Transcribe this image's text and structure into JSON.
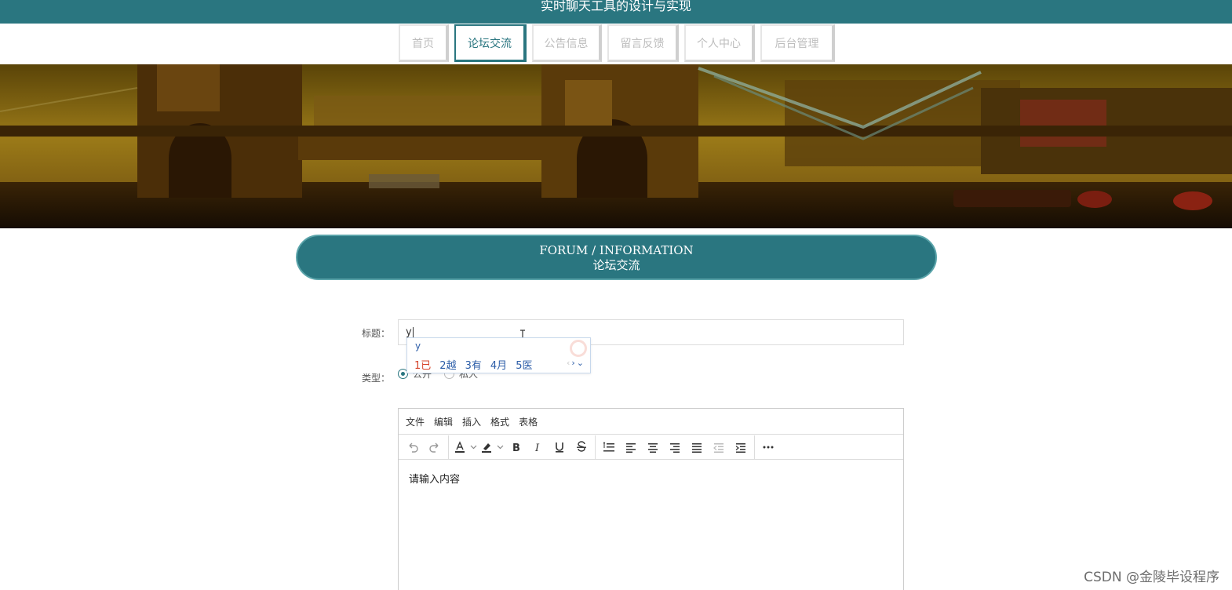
{
  "header": {
    "title": "实时聊天工具的设计与实现"
  },
  "nav": {
    "items": [
      {
        "label": "首页"
      },
      {
        "label": "论坛交流"
      },
      {
        "label": "公告信息"
      },
      {
        "label": "留言反馈"
      },
      {
        "label": "个人中心"
      },
      {
        "label": "后台管理"
      }
    ],
    "active_index": 1
  },
  "section": {
    "title_en": "FORUM / INFORMATION",
    "title_cn": "论坛交流"
  },
  "form": {
    "title_label": "标题：",
    "title_value": "y",
    "type_label": "类型：",
    "type_options": [
      {
        "label": "公开"
      },
      {
        "label": "私人"
      }
    ],
    "type_selected": "公开"
  },
  "ime": {
    "composition": "y",
    "candidates": [
      {
        "num": "1",
        "text": "已"
      },
      {
        "num": "2",
        "text": "越"
      },
      {
        "num": "3",
        "text": "有"
      },
      {
        "num": "4",
        "text": "月"
      },
      {
        "num": "5",
        "text": "医"
      }
    ]
  },
  "editor": {
    "menus": [
      {
        "label": "文件"
      },
      {
        "label": "编辑"
      },
      {
        "label": "插入"
      },
      {
        "label": "格式"
      },
      {
        "label": "表格"
      }
    ],
    "placeholder": "请输入内容",
    "toolbar_icons": [
      "undo-icon",
      "redo-icon",
      "text-color-icon",
      "highlight-icon",
      "bold-icon",
      "italic-icon",
      "underline-icon",
      "strikethrough-icon",
      "line-height-icon",
      "align-left-icon",
      "align-center-icon",
      "align-right-icon",
      "align-justify-icon",
      "outdent-icon",
      "indent-icon",
      "more-icon"
    ]
  },
  "colors": {
    "primary": "#2a7680",
    "ime_blue": "#2c5da8",
    "ime_red": "#d6442b"
  },
  "watermark": "CSDN @金陵毕设程序"
}
